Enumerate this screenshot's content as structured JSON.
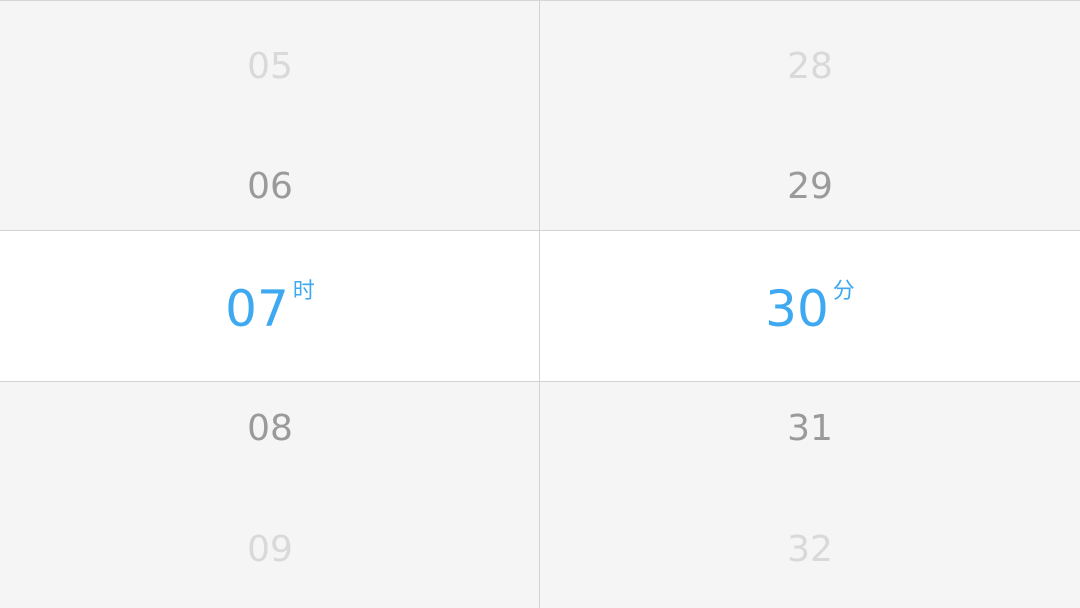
{
  "colors": {
    "selected_text": "#3ea8f0",
    "near_text": "#9a9a9a",
    "far_text": "#d9d9d9",
    "background": "#f5f5f5",
    "selection_background": "#ffffff",
    "border": "#d2d2d2"
  },
  "hour_column": {
    "items": [
      "05",
      "06",
      "07",
      "08",
      "09"
    ],
    "selected_value": "07",
    "unit": "时"
  },
  "minute_column": {
    "items": [
      "28",
      "29",
      "30",
      "31",
      "32"
    ],
    "selected_value": "30",
    "unit": "分"
  }
}
